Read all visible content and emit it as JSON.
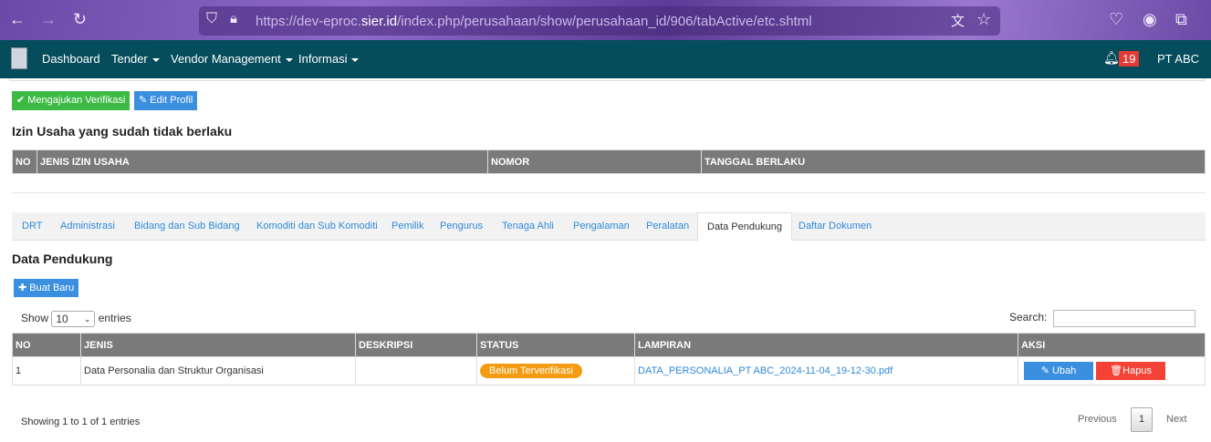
{
  "browser": {
    "url_domain_pre": "https://dev-eproc.",
    "url_domain": "sier.id",
    "url_path": "/index.php/perusahaan/show/perusahaan_id/906/tabActive/etc.shtml"
  },
  "nav": {
    "items": [
      "Dashboard",
      "Tender",
      "Vendor Management",
      "Informasi"
    ],
    "notif_count": "19",
    "user": "PT ABC"
  },
  "actions": {
    "verify": "Mengajukan Verifikasi",
    "edit": "Edit Profil"
  },
  "expired": {
    "title": "Izin Usaha yang sudah tidak berlaku",
    "headers": [
      "NO",
      "JENIS IZIN USAHA",
      "NOMOR",
      "TANGGAL BERLAKU"
    ]
  },
  "tabs": [
    "DRT",
    "Administrasi",
    "Bidang dan Sub Bidang",
    "Komoditi dan Sub Komoditi",
    "Pemilik",
    "Pengurus",
    "Tenaga Ahli",
    "Pengalaman",
    "Peralatan",
    "Data Pendukung",
    "Daftar Dokumen"
  ],
  "section": {
    "title": "Data Pendukung",
    "new_button": "Buat Baru",
    "show": "Show",
    "entries_value": "10",
    "entries": "entries",
    "search_label": "Search:"
  },
  "table": {
    "headers": [
      "NO",
      "JENIS",
      "DESKRIPSI",
      "STATUS",
      "LAMPIRAN",
      "AKSI"
    ],
    "rows": [
      {
        "no": "1",
        "jenis": "Data Personalia dan Struktur Organisasi",
        "deskripsi": "",
        "status": "Belum Terverifikasi",
        "lampiran": "DATA_PERSONALIA_PT ABC_2024-11-04_19-12-30.pdf",
        "edit": "Ubah",
        "delete": "Hapus"
      }
    ]
  },
  "footer": {
    "info": "Showing 1 to 1 of 1 entries",
    "previous": "Previous",
    "page": "1",
    "next": "Next"
  }
}
